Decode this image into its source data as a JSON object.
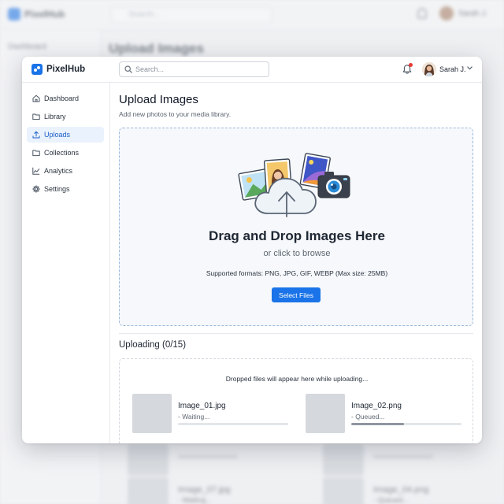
{
  "app": {
    "brand": "PixelHub"
  },
  "search": {
    "placeholder": "Search..."
  },
  "user": {
    "name": "Sarah J."
  },
  "sidebar": {
    "items": [
      {
        "label": "Dashboard",
        "icon": "home-icon",
        "active": false
      },
      {
        "label": "Library",
        "icon": "folder-icon",
        "active": false
      },
      {
        "label": "Uploads",
        "icon": "upload-icon",
        "active": true
      },
      {
        "label": "Collections",
        "icon": "folder-icon",
        "active": false
      },
      {
        "label": "Analytics",
        "icon": "chart-icon",
        "active": false
      },
      {
        "label": "Settings",
        "icon": "gear-icon",
        "active": false
      }
    ]
  },
  "main": {
    "title": "Upload Images",
    "subtitle": "Add new photos to your media library.",
    "dropzone": {
      "title": "Drag and Drop Images Here",
      "subtitle": "or click to browse",
      "formats": "Supported formats: PNG, JPG, GIF, WEBP (Max size: 25MB)",
      "button": "Select Files"
    },
    "uploading_title": "Uploading (0/15)",
    "queue_hint": "Dropped files will appear here while uploading...",
    "files": [
      {
        "name": "Image_01.jpg",
        "status": "- Waiting...",
        "progress": 0
      },
      {
        "name": "Image_02.png",
        "status": "- Queued...",
        "progress": 0.48
      }
    ]
  },
  "background": {
    "brand": "PixelHub",
    "search_placeholder": "Search...",
    "user": "Sarah J.",
    "title": "Upload Images",
    "sidebar_first": "Dashboard",
    "file_a": "Image_07.jpg",
    "file_b": "Image_04.png",
    "status_a": "- Waiting...",
    "status_b": "- Queued..."
  },
  "colors": {
    "accent": "#1a73e8",
    "active_bg": "#eaf2fd",
    "notification": "#e53935"
  }
}
